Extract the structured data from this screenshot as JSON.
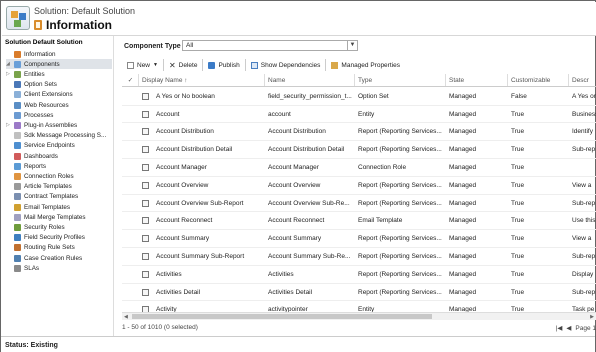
{
  "header": {
    "breadcrumb": "Solution: Default Solution",
    "title": "Information"
  },
  "sidebar": {
    "title": "Solution Default Solution",
    "items": [
      {
        "label": "Information",
        "color": "#d97c2b",
        "expander": ""
      },
      {
        "label": "Components",
        "color": "#6a9fd8",
        "expander": "◢",
        "selected": true
      },
      {
        "label": "Entities",
        "color": "#7aa34b",
        "expander": "▷"
      },
      {
        "label": "Option Sets",
        "color": "#4b78b8",
        "expander": ""
      },
      {
        "label": "Client Extensions",
        "color": "#8bb0d8",
        "expander": ""
      },
      {
        "label": "Web Resources",
        "color": "#5a8ec5",
        "expander": ""
      },
      {
        "label": "Processes",
        "color": "#6c9bd2",
        "expander": ""
      },
      {
        "label": "Plug-in Assemblies",
        "color": "#9c7ac8",
        "expander": "▷"
      },
      {
        "label": "Sdk Message Processing S...",
        "color": "#c0c0c0",
        "expander": ""
      },
      {
        "label": "Service Endpoints",
        "color": "#4e8fd0",
        "expander": ""
      },
      {
        "label": "Dashboards",
        "color": "#d15b5b",
        "expander": ""
      },
      {
        "label": "Reports",
        "color": "#5b9bd5",
        "expander": ""
      },
      {
        "label": "Connection Roles",
        "color": "#e09440",
        "expander": ""
      },
      {
        "label": "Article Templates",
        "color": "#9a9a9a",
        "expander": ""
      },
      {
        "label": "Contract Templates",
        "color": "#7b8fb0",
        "expander": ""
      },
      {
        "label": "Email Templates",
        "color": "#d0a030",
        "expander": ""
      },
      {
        "label": "Mail Merge Templates",
        "color": "#a0a0c0",
        "expander": ""
      },
      {
        "label": "Security Roles",
        "color": "#6f9c3c",
        "expander": ""
      },
      {
        "label": "Field Security Profiles",
        "color": "#3f7fc0",
        "expander": ""
      },
      {
        "label": "Routing Rule Sets",
        "color": "#c07030",
        "expander": ""
      },
      {
        "label": "Case Creation Rules",
        "color": "#5080b0",
        "expander": ""
      },
      {
        "label": "SLAs",
        "color": "#8a8a8a",
        "expander": ""
      }
    ]
  },
  "filter": {
    "label": "Component Type",
    "value": "All"
  },
  "toolbar": {
    "new": "New",
    "delete": "Delete",
    "publish": "Publish",
    "show_dependencies": "Show Dependencies",
    "managed_properties": "Managed Properties"
  },
  "grid": {
    "columns": [
      "Display Name ↑",
      "Name",
      "Type",
      "State",
      "Customizable",
      "Descr"
    ],
    "rows": [
      {
        "display": "A Yes or No boolean",
        "name": "field_security_permission_t...",
        "type": "Option Set",
        "state": "Managed",
        "customizable": "False",
        "desc": "A Yes or"
      },
      {
        "display": "Account",
        "name": "account",
        "type": "Entity",
        "state": "Managed",
        "customizable": "True",
        "desc": "Business"
      },
      {
        "display": "Account Distribution",
        "name": "Account Distribution",
        "type": "Report (Reporting Services...",
        "state": "Managed",
        "customizable": "True",
        "desc": "Identify"
      },
      {
        "display": "Account Distribution Detail",
        "name": "Account Distribution Detail",
        "type": "Report (Reporting Services...",
        "state": "Managed",
        "customizable": "True",
        "desc": "Sub-rep"
      },
      {
        "display": "Account Manager",
        "name": "Account Manager",
        "type": "Connection Role",
        "state": "Managed",
        "customizable": "True",
        "desc": ""
      },
      {
        "display": "Account Overview",
        "name": "Account Overview",
        "type": "Report (Reporting Services...",
        "state": "Managed",
        "customizable": "True",
        "desc": "View a"
      },
      {
        "display": "Account Overview Sub-Report",
        "name": "Account Overview Sub-Re...",
        "type": "Report (Reporting Services...",
        "state": "Managed",
        "customizable": "True",
        "desc": "Sub-rep"
      },
      {
        "display": "Account Reconnect",
        "name": "Account Reconnect",
        "type": "Email Template",
        "state": "Managed",
        "customizable": "True",
        "desc": "Use this"
      },
      {
        "display": "Account Summary",
        "name": "Account Summary",
        "type": "Report (Reporting Services...",
        "state": "Managed",
        "customizable": "True",
        "desc": "View a"
      },
      {
        "display": "Account Summary Sub-Report",
        "name": "Account Summary Sub-Re...",
        "type": "Report (Reporting Services...",
        "state": "Managed",
        "customizable": "True",
        "desc": "Sub-rep"
      },
      {
        "display": "Activities",
        "name": "Activities",
        "type": "Report (Reporting Services...",
        "state": "Managed",
        "customizable": "True",
        "desc": "Display"
      },
      {
        "display": "Activities Detail",
        "name": "Activities Detail",
        "type": "Report (Reporting Services...",
        "state": "Managed",
        "customizable": "True",
        "desc": "Sub-rep"
      },
      {
        "display": "Activity",
        "name": "activitypointer",
        "type": "Entity",
        "state": "Managed",
        "customizable": "True",
        "desc": "Task pe"
      }
    ]
  },
  "footer": {
    "count": "1 - 50 of 1010 (0 selected)",
    "page": "Page 1"
  },
  "status": "Status: Existing"
}
